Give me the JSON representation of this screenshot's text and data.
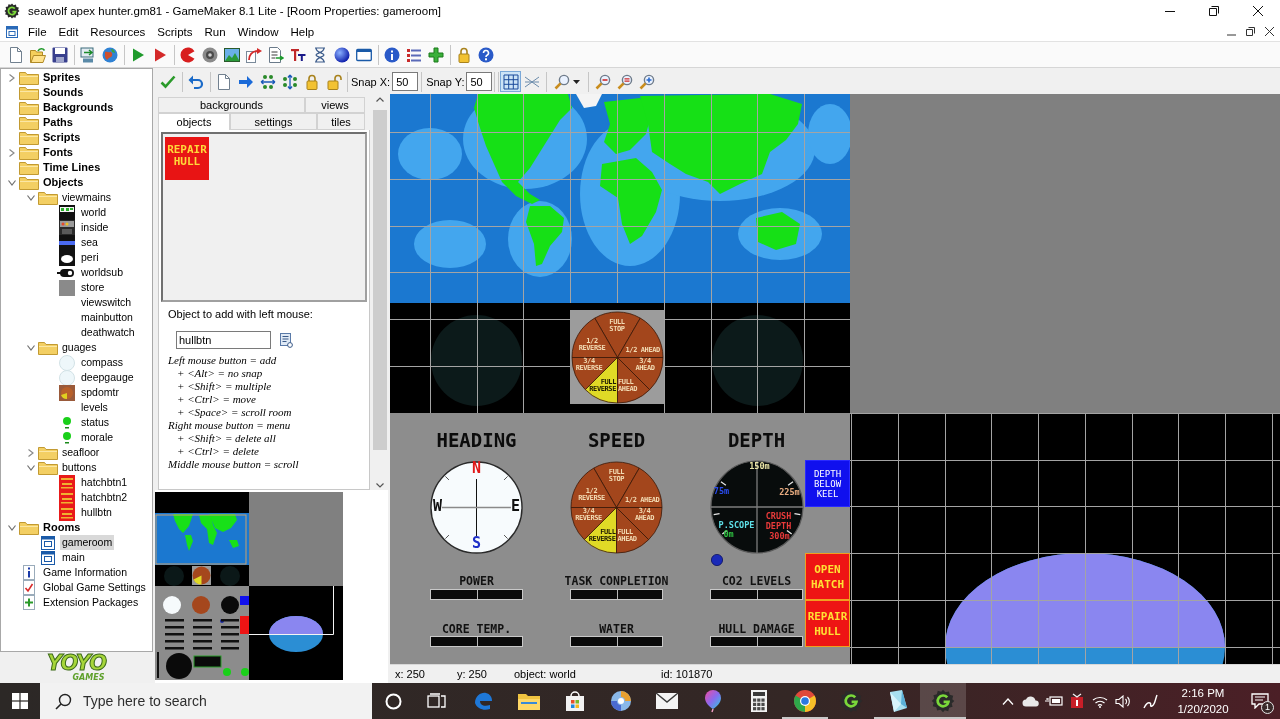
{
  "window": {
    "title": "seawolf apex hunter.gm81 - GameMaker 8.1 Lite - [Room Properties: gameroom]"
  },
  "menu": [
    "File",
    "Edit",
    "Resources",
    "Scripts",
    "Run",
    "Window",
    "Help"
  ],
  "resource_tree": [
    {
      "label": "Sprites",
      "kind": "folder",
      "expanded": false,
      "selected": false
    },
    {
      "label": "Sounds",
      "kind": "folder",
      "selected": false
    },
    {
      "label": "Backgrounds",
      "kind": "folder",
      "selected": false
    },
    {
      "label": "Paths",
      "kind": "folder",
      "selected": false
    },
    {
      "label": "Scripts",
      "kind": "folder",
      "selected": false
    },
    {
      "label": "Fonts",
      "kind": "folder",
      "expanded": false,
      "selected": false
    },
    {
      "label": "Time Lines",
      "kind": "folder",
      "selected": false
    },
    {
      "label": "Objects",
      "kind": "folder",
      "expanded": true,
      "selected": false,
      "children": [
        {
          "label": "viewmains",
          "kind": "folder",
          "expanded": true,
          "selected": false,
          "children": [
            {
              "label": "world",
              "kind": "map",
              "selected": false
            },
            {
              "label": "inside",
              "kind": "panel",
              "selected": false
            },
            {
              "label": "sea",
              "kind": "stripe",
              "selected": false
            },
            {
              "label": "peri",
              "kind": "oval",
              "selected": false
            },
            {
              "label": "worldsub",
              "kind": "sub",
              "selected": false
            },
            {
              "label": "store",
              "kind": "block",
              "selected": false
            },
            {
              "label": "viewswitch",
              "kind": "plain",
              "selected": false
            },
            {
              "label": "mainbutton",
              "kind": "plain",
              "selected": false
            },
            {
              "label": "deathwatch",
              "kind": "plain",
              "selected": false
            }
          ]
        },
        {
          "label": "guages",
          "kind": "folder",
          "expanded": true,
          "selected": false,
          "children": [
            {
              "label": "compass",
              "kind": "dial",
              "selected": false
            },
            {
              "label": "deepgauge",
              "kind": "dial",
              "selected": false
            },
            {
              "label": "spdomtr",
              "kind": "pie",
              "selected": false
            },
            {
              "label": "levels",
              "kind": "plain",
              "selected": false
            },
            {
              "label": "status",
              "kind": "dot",
              "selected": false
            },
            {
              "label": "morale",
              "kind": "dot",
              "selected": false
            }
          ]
        },
        {
          "label": "seafloor",
          "kind": "folder",
          "expanded": false,
          "selected": false
        },
        {
          "label": "buttons",
          "kind": "folder",
          "expanded": true,
          "selected": false,
          "children": [
            {
              "label": "hatchbtn1",
              "kind": "button",
              "selected": false
            },
            {
              "label": "hatchbtn2",
              "kind": "button",
              "selected": false
            },
            {
              "label": "hullbtn",
              "kind": "button",
              "selected": false
            }
          ]
        }
      ]
    },
    {
      "label": "Rooms",
      "kind": "folder",
      "expanded": true,
      "selected": false,
      "children": [
        {
          "label": "gameroom",
          "kind": "room",
          "selected": true
        },
        {
          "label": "main",
          "kind": "room",
          "selected": false
        }
      ]
    },
    {
      "label": "Game Information",
      "kind": "info",
      "selected": false
    },
    {
      "label": "Global Game Settings",
      "kind": "settings",
      "selected": false
    },
    {
      "label": "Extension Packages",
      "kind": "extensions",
      "selected": false
    }
  ],
  "logo": {
    "top": "YOYO",
    "bottom": "GAMES"
  },
  "room_toolbar": {
    "snap_x": {
      "label": "Snap X:",
      "value": "50"
    },
    "snap_y": {
      "label": "Snap Y:",
      "value": "50"
    },
    "grid_toggle": {
      "on": true
    },
    "pattern_toggle": {
      "on": false
    }
  },
  "room_panel": {
    "tabs": [
      [
        {
          "label": "backgrounds",
          "selected": false
        },
        {
          "label": "views",
          "selected": false
        }
      ],
      [
        {
          "label": "objects",
          "selected": true
        },
        {
          "label": "settings",
          "selected": false
        },
        {
          "label": "tiles",
          "selected": false
        }
      ]
    ],
    "object_preview": {
      "label": "REPAIR HULL"
    },
    "add_label": "Object to add with left mouse:",
    "object_field": {
      "value": "hullbtn"
    },
    "help": [
      {
        "text": "Left mouse button = add",
        "children": [
          "+ <Alt> = no snap",
          "+ <Shift> = multiple",
          "+ <Ctrl> = move",
          "+ <Space> = scroll room"
        ]
      },
      {
        "text": "Right mouse button = menu",
        "children": [
          "+ <Shift> = delete all",
          "+ <Ctrl> = delete"
        ]
      },
      {
        "text": "Middle mouse button = scroll"
      }
    ]
  },
  "room_canvas": {
    "strip_dial": {
      "segments": [
        {
          "label": "FULL STOP",
          "selected": false
        },
        {
          "label": "1/2 REVERSE",
          "selected": false
        },
        {
          "label": "1/2 AHEAD",
          "selected": false
        },
        {
          "label": "3/4 REVERSE",
          "selected": false
        },
        {
          "label": "3/4 AHEAD",
          "selected": false
        },
        {
          "label": "FULL REVERSE",
          "selected": true
        },
        {
          "label": "FULL AHEAD",
          "selected": false
        }
      ]
    },
    "gauges": [
      {
        "title": "HEADING",
        "kind": "compass",
        "points": [
          {
            "label": "N",
            "color": "#e01818"
          },
          {
            "label": "E",
            "color": "#101010"
          },
          {
            "label": "S",
            "color": "#2030c8"
          },
          {
            "label": "W",
            "color": "#101010"
          }
        ]
      },
      {
        "title": "SPEED",
        "kind": "speed",
        "segments": [
          {
            "label": "FULL STOP",
            "selected": false
          },
          {
            "label": "1/2 REVERSE",
            "selected": false
          },
          {
            "label": "1/2 AHEAD",
            "selected": false
          },
          {
            "label": "3/4 REVERSE",
            "selected": false
          },
          {
            "label": "3/4 AHEAD",
            "selected": false
          },
          {
            "label": "FULL REVERSE",
            "selected": true
          },
          {
            "label": "FULL AHEAD",
            "selected": false
          }
        ]
      },
      {
        "title": "DEPTH",
        "kind": "depth",
        "marks": [
          {
            "label": "150m",
            "color": "#ece6a8"
          },
          {
            "label": "75m",
            "color": "#2a4cf0"
          },
          {
            "label": "225m",
            "color": "#e8ac80"
          },
          {
            "label": "P.SCOPE",
            "color": "#5ee0e8"
          },
          {
            "label": "0m",
            "color": "#2ec040"
          },
          {
            "label": "CRUSH DEPTH",
            "color": "#e83a3a"
          },
          {
            "label": "300m",
            "color": "#e83a3a"
          }
        ]
      }
    ],
    "buttons": [
      {
        "label": "DEPTH BELOW KEEL",
        "kind": "info",
        "color": "#1010ee"
      },
      {
        "label": "OPEN HATCH",
        "kind": "action",
        "color": "#ee1414"
      },
      {
        "label": "REPAIR HULL",
        "kind": "action",
        "color": "#ee1414"
      }
    ],
    "meters": [
      "POWER",
      "TASK CONPLETION",
      "CO2 LEVELS",
      "CORE TEMP.",
      "WATER",
      "HULL DAMAGE"
    ]
  },
  "status_bar": [
    "x: 250",
    "y: 250",
    "object: world",
    "id: 101870"
  ],
  "taskbar": {
    "search": {
      "placeholder": "Type here to search"
    },
    "apps": [
      {
        "kind": "edge",
        "selected": false,
        "running": false
      },
      {
        "kind": "explorer",
        "selected": false,
        "running": false
      },
      {
        "kind": "store",
        "selected": false,
        "running": false
      },
      {
        "kind": "swirl",
        "selected": false,
        "running": false
      },
      {
        "kind": "mail",
        "selected": false,
        "running": false
      },
      {
        "kind": "balloon",
        "selected": false,
        "running": false
      },
      {
        "kind": "calculator",
        "selected": false,
        "running": false
      },
      {
        "kind": "chrome",
        "selected": false,
        "running": true
      },
      {
        "kind": "gamemaker",
        "selected": false,
        "running": false
      },
      {
        "kind": "crystal",
        "selected": false,
        "running": true
      },
      {
        "kind": "gamemaker",
        "selected": true,
        "running": true
      }
    ],
    "clock": {
      "time": "2:16 PM",
      "date": "1/20/2020"
    },
    "notifications": {
      "count": "1"
    }
  }
}
